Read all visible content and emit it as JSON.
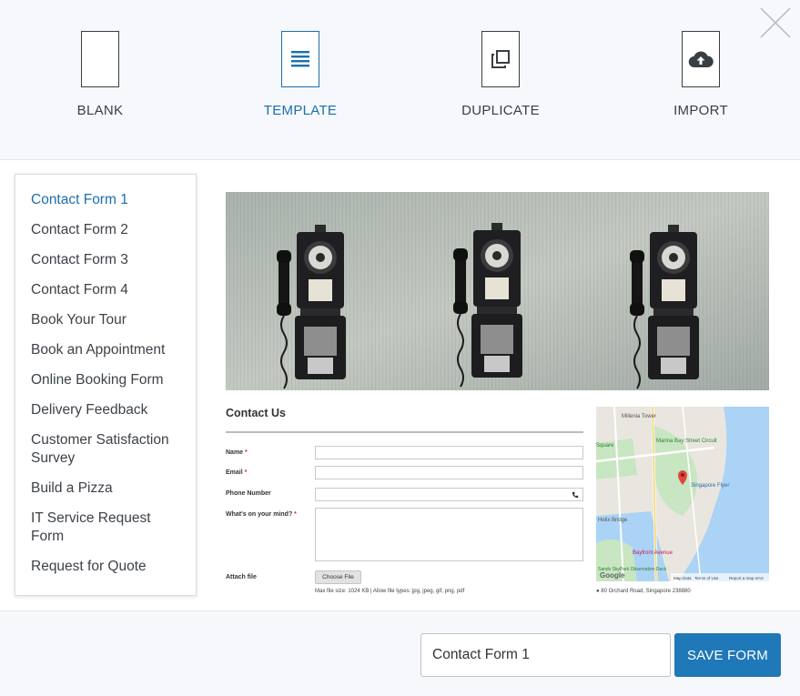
{
  "options": [
    {
      "label": "BLANK",
      "icon": "blank-document-icon"
    },
    {
      "label": "TEMPLATE",
      "icon": "template-document-icon",
      "active": true
    },
    {
      "label": "DUPLICATE",
      "icon": "duplicate-icon"
    },
    {
      "label": "IMPORT",
      "icon": "cloud-upload-icon"
    }
  ],
  "templates": [
    "Contact Form 1",
    "Contact Form 2",
    "Contact Form 3",
    "Contact Form 4",
    "Book Your Tour",
    "Book an Appointment",
    "Online Booking Form",
    "Delivery Feedback",
    "Customer Satisfaction Survey",
    "Build a Pizza",
    "IT Service Request Form",
    "Request for Quote"
  ],
  "selected_template_index": 0,
  "preview": {
    "title": "Contact Us",
    "fields": [
      {
        "label": "Name",
        "required": "*"
      },
      {
        "label": "Email",
        "required": "*"
      },
      {
        "label": "Phone Number",
        "required": ""
      },
      {
        "label": "What's on your mind?",
        "required": "*"
      }
    ],
    "attach_label": "Attach file",
    "choose_file_label": "Choose File",
    "file_note": "Max file size: 1024 KB | Allow file types: jpg, jpeg, gif, png, pdf",
    "map_labels": {
      "poi1": "Millenia Tower",
      "poi2": "Marina Bay Street Circuit",
      "poi3": "Singapore Flyer",
      "poi4": "Helix Bridge",
      "poi5": "Bayfront Avenue",
      "poi6": "Sands SkyPark Observation Deck",
      "square": "Square",
      "google": "Google",
      "map_data": "Map Data",
      "terms": "Terms of Use",
      "report": "Report a map error"
    },
    "address": "80 Orchard Road, Singapore 238880"
  },
  "footer": {
    "form_name_value": "Contact Form 1",
    "save_label": "SAVE FORM"
  },
  "colors": {
    "accent": "#1b6fae",
    "button": "#1f78b8",
    "required": "#d9262c"
  }
}
